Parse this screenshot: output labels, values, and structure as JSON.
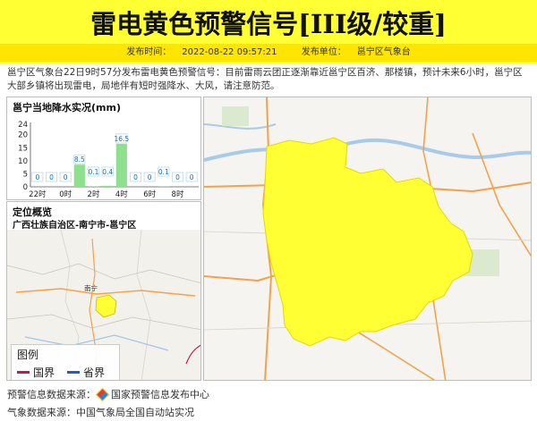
{
  "header": {
    "title": "雷电黄色预警信号[III级/较重]",
    "publish_time_label": "发布时间：",
    "publish_time": "2022-08-22 09:57:21",
    "publisher_label": "发布单位：",
    "publisher": "邕宁区气象台",
    "colors": {
      "banner": "#ffff33",
      "meta_bar": "#ffe600"
    }
  },
  "description": "邕宁区气象台22日9时57分发布雷电黄色预警信号：目前雷雨云团正逐渐靠近邕宁区百济、那楼镇，预计未来6小时，邕宁区大部乡镇将出现雷电，局地伴有短时强降水、大风，请注意防范。",
  "rain_panel": {
    "title": "邕宁当地降水实况(mm)"
  },
  "chart_data": {
    "type": "bar",
    "title": "邕宁当地降水实况(mm)",
    "y_ticks": [
      "24",
      "20",
      "15",
      "10",
      "5",
      "0"
    ],
    "ylim": [
      0,
      24
    ],
    "x_tick_labels": [
      "22时",
      "0时",
      "2时",
      "4时",
      "6时",
      "8时"
    ],
    "values": [
      0,
      0,
      0,
      8.5,
      0.1,
      0.4,
      16.5,
      0,
      0,
      0.1,
      0,
      0
    ],
    "value_labels": [
      "0",
      "0",
      "0",
      "8.5",
      "0.1",
      "0.4",
      "16.5",
      "0",
      "0",
      "0.1",
      "0",
      "0"
    ],
    "bar_color": "#8ee08e"
  },
  "location_panel": {
    "title": "定位概览",
    "subtitle": "广西壮族自治区-南宁市-邕宁区",
    "map_labels": [
      "南宁"
    ],
    "legend": {
      "title": "图例",
      "items": [
        {
          "label": "国界",
          "color": "#c2185b"
        },
        {
          "label": "省界",
          "color": "#1565c0"
        }
      ]
    }
  },
  "big_map": {
    "warning_area_color": "#ffff33"
  },
  "footer": {
    "warning_source_label": "预警信息数据来源：",
    "warning_source": "国家预警信息发布中心",
    "weather_source_label": "气象数据来源：",
    "weather_source": "中国气象局全国自动站实况"
  }
}
